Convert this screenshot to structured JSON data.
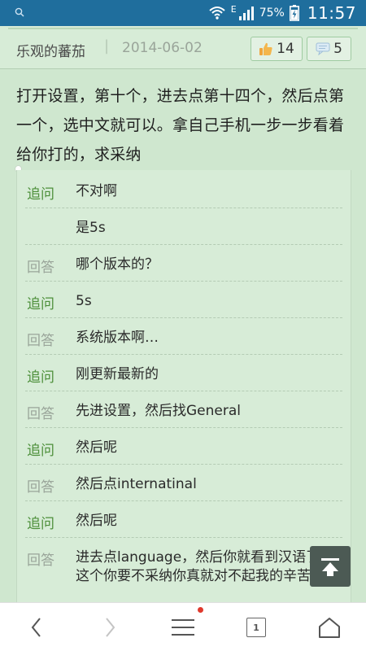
{
  "status_bar": {
    "battery": "75%",
    "network_label": "E",
    "time": "11:57"
  },
  "header": {
    "username": "乐观的蕃茄",
    "separator": "|",
    "date": "2014-06-02",
    "likes": "14",
    "comments": "5"
  },
  "answer": {
    "text": "打开设置，第十个，进去点第十四个，然后点第一个，选中文就可以。拿自己手机一步一步看着给你打的，求采纳"
  },
  "qa": [
    {
      "label": "追问",
      "type": "q",
      "text": "不对啊"
    },
    {
      "label": "",
      "type": "q",
      "text": "是5s"
    },
    {
      "label": "回答",
      "type": "a",
      "text": "哪个版本的？"
    },
    {
      "label": "追问",
      "type": "q",
      "text": "5s"
    },
    {
      "label": "回答",
      "type": "a",
      "text": "系统版本啊…"
    },
    {
      "label": "追问",
      "type": "q",
      "text": "刚更新最新的"
    },
    {
      "label": "回答",
      "type": "a",
      "text": "先进设置，然后找General"
    },
    {
      "label": "追问",
      "type": "q",
      "text": "然后呢"
    },
    {
      "label": "回答",
      "type": "a",
      "text": "然后点internatinal"
    },
    {
      "label": "追问",
      "type": "q",
      "text": "然后呢"
    },
    {
      "label": "回答",
      "type": "a",
      "text": "进去点language，然后你就看到汉语了…这个你要不采纳你真就对不起我的辛苦了"
    }
  ],
  "toolbar": {
    "tab_count": "1"
  },
  "colors": {
    "status_bar": "#1f6e9d",
    "page_bg": "#cfe7cf",
    "question_label": "#4d8f3a",
    "answer_label": "#9aa59a",
    "notification_dot": "#e0392d"
  }
}
